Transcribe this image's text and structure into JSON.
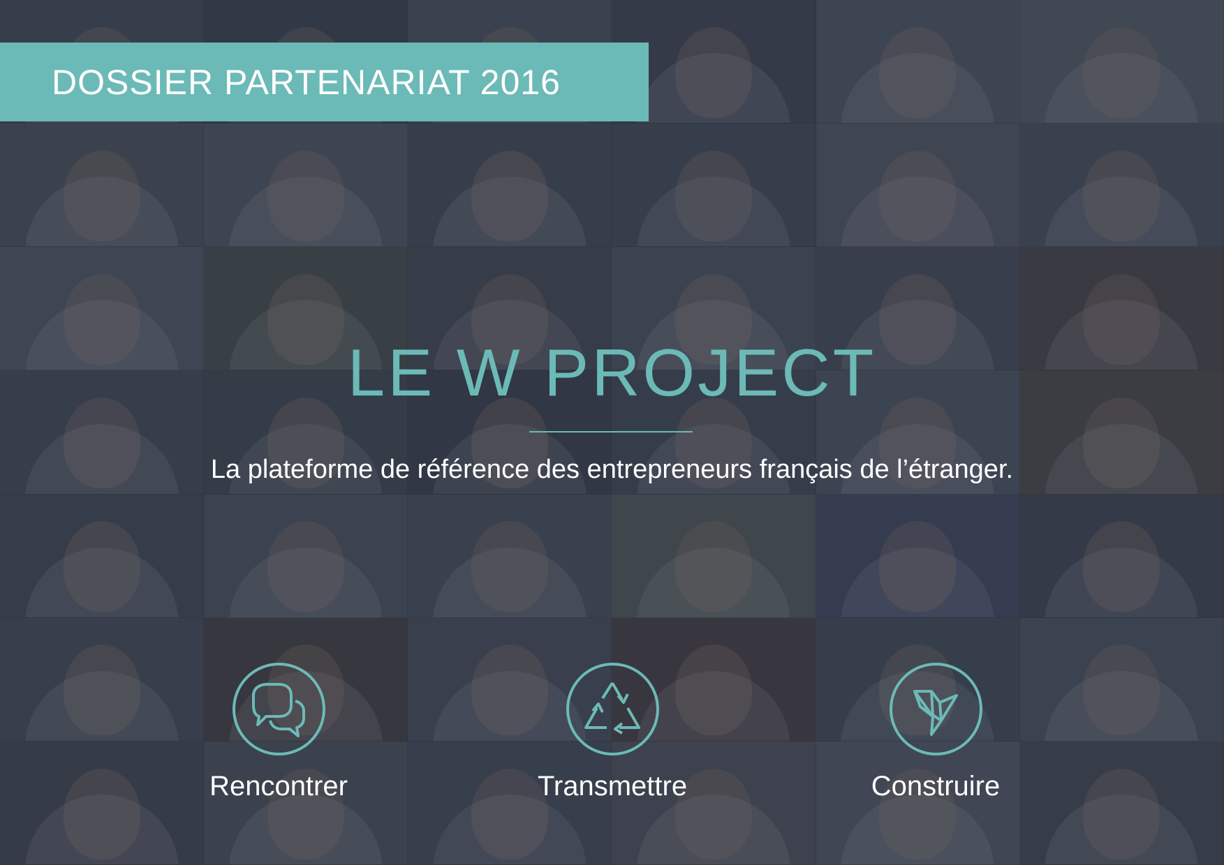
{
  "banner": {
    "text": "DOSSIER PARTENARIAT 2016"
  },
  "title": "LE W PROJECT",
  "subtitle": "La plateforme de référence des entrepreneurs français de l’étranger.",
  "features": [
    {
      "label": "Rencontrer",
      "icon": "speech-bubbles-icon"
    },
    {
      "label": "Transmettre",
      "icon": "recycle-triangle-icon"
    },
    {
      "label": "Construire",
      "icon": "origami-bird-icon"
    }
  ],
  "colors": {
    "accent": "#6cbab7",
    "text": "#ffffff",
    "overlay": "#262c3a"
  }
}
